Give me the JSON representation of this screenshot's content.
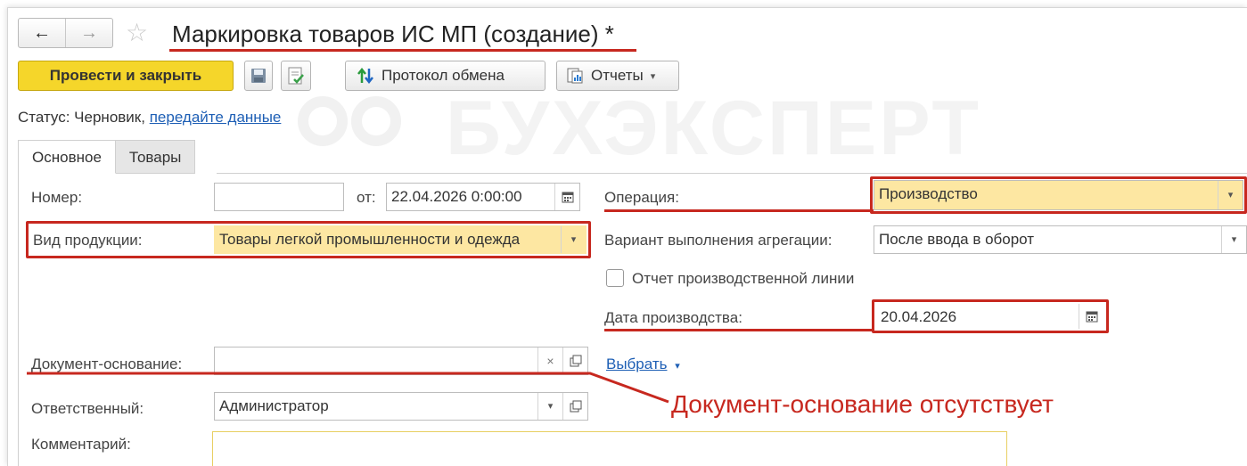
{
  "window": {
    "title": "Маркировка товаров ИС МП (создание) *",
    "back_icon": "←",
    "forward_icon": "→",
    "favorite_icon": "☆"
  },
  "toolbar": {
    "post_close_label": "Провести и закрыть",
    "exchange_log_label": "Протокол обмена",
    "reports_label": "Отчеты",
    "dropdown_glyph": "▾"
  },
  "status": {
    "label": "Статус: Черновик,",
    "link": "передайте данные"
  },
  "watermark": "БУХЭКСПЕРТ",
  "tabs": [
    {
      "label": "Основное"
    },
    {
      "label": "Товары"
    }
  ],
  "form": {
    "number_label": "Номер:",
    "number_value": "",
    "from_label": "от:",
    "date_value": "22.04.2026  0:00:00",
    "operation_label": "Операция:",
    "operation_value": "Производство",
    "product_type_label": "Вид продукции:",
    "product_type_value": "Товары легкой промышленности и одежда",
    "aggregation_label": "Вариант выполнения агрегации:",
    "aggregation_value": "После ввода в оборот",
    "production_line_report_label": "Отчет производственной линии",
    "production_line_report_checked": false,
    "production_date_label": "Дата производства:",
    "production_date_value": "20.04.2026",
    "base_document_label": "Документ-основание:",
    "base_document_value": "",
    "select_link": "Выбрать",
    "responsible_label": "Ответственный:",
    "responsible_value": "Администратор",
    "comment_label": "Комментарий:",
    "comment_value": ""
  },
  "annotation": {
    "text": "Документ-основание отсутствует",
    "color": "#c7281f"
  },
  "colors": {
    "primary_button": "#f5d62a",
    "highlight_field": "#fde7a2",
    "link": "#1e5fb5",
    "annotation_red": "#c7281f"
  }
}
